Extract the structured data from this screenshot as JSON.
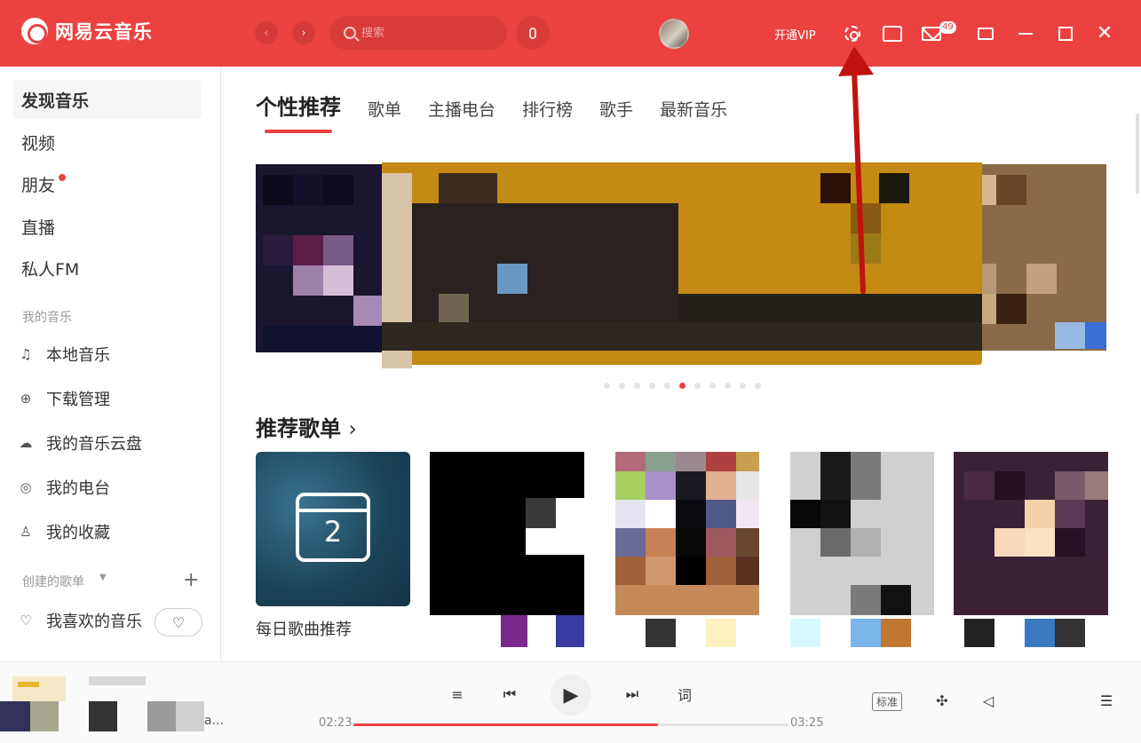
{
  "app": {
    "name": "网易云音乐"
  },
  "header": {
    "search_placeholder": "搜索",
    "vip_label": "开通VIP",
    "mail_badge": "49",
    "back_glyph": "‹",
    "forward_glyph": "›",
    "icons": [
      "settings-icon",
      "skin-icon",
      "mail-icon",
      "mini-mode-icon",
      "minimize-icon",
      "maximize-icon",
      "close-icon"
    ]
  },
  "sidebar": {
    "main_items": [
      {
        "label": "发现音乐",
        "active": true
      },
      {
        "label": "视频"
      },
      {
        "label": "朋友",
        "dot": true
      },
      {
        "label": "直播"
      },
      {
        "label": "私人FM"
      }
    ],
    "my_music_label": "我的音乐",
    "my_music_items": [
      {
        "label": "本地音乐",
        "icon": "music-note-icon"
      },
      {
        "label": "下载管理",
        "icon": "download-icon"
      },
      {
        "label": "我的音乐云盘",
        "icon": "cloud-icon"
      },
      {
        "label": "我的电台",
        "icon": "radio-icon"
      },
      {
        "label": "我的收藏",
        "icon": "collection-icon"
      }
    ],
    "created_label": "创建的歌单",
    "liked_label": "我喜欢的音乐"
  },
  "main": {
    "tabs": [
      "个性推荐",
      "歌单",
      "主播电台",
      "排行榜",
      "歌手",
      "最新音乐"
    ],
    "banner_dots": 11,
    "banner_active_dot": 5,
    "section_title": "推荐歌单",
    "section_chevron": "›",
    "daily_number": "2",
    "daily_label": "每日歌曲推荐"
  },
  "player": {
    "current_time": "02:23",
    "total_time": "03:25",
    "progress": 0.7,
    "lyrics_label": "词",
    "quality_label": "标准",
    "song_name_fragment": "a..."
  },
  "colors": {
    "accent": "#ec4141",
    "annotation_arrow": "#c0120f"
  }
}
